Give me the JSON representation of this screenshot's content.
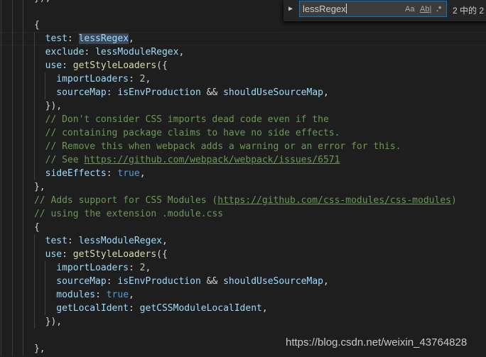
{
  "find_widget": {
    "query": "lessRegex",
    "match_case_label": "Aa",
    "whole_word_label": "Ab|",
    "regex_label": ".*",
    "result_count": "2 中的 2"
  },
  "watermark": "https://blog.csdn.net/weixin_43764828",
  "colors": {
    "background": "#1e1e1e",
    "property": "#9cdcfe",
    "function": "#dcdcaa",
    "number": "#b5cea8",
    "comment": "#6a9955",
    "keyword": "#569cd6"
  },
  "code_lines": [
    {
      "indent": 3,
      "tokens": [
        [
          "p",
          "      }),"
        ]
      ]
    },
    {
      "indent": 3,
      "tokens": []
    },
    {
      "indent": 3,
      "tokens": [
        [
          "p",
          "      {"
        ]
      ]
    },
    {
      "indent": 4,
      "current": true,
      "tokens": [
        [
          "prop",
          "        test"
        ],
        [
          "p",
          ": "
        ],
        [
          "hl",
          "lessRegex"
        ],
        [
          "p",
          ","
        ]
      ]
    },
    {
      "indent": 4,
      "tokens": [
        [
          "prop",
          "        exclude"
        ],
        [
          "p",
          ": "
        ],
        [
          "prop",
          "lessModuleRegex"
        ],
        [
          "p",
          ","
        ]
      ]
    },
    {
      "indent": 4,
      "tokens": [
        [
          "prop",
          "        use"
        ],
        [
          "p",
          ": "
        ],
        [
          "fn",
          "getStyleLoaders"
        ],
        [
          "p",
          "({"
        ]
      ]
    },
    {
      "indent": 5,
      "tokens": [
        [
          "prop",
          "          importLoaders"
        ],
        [
          "p",
          ": "
        ],
        [
          "num",
          "2"
        ],
        [
          "p",
          ","
        ]
      ]
    },
    {
      "indent": 5,
      "tokens": [
        [
          "prop",
          "          sourceMap"
        ],
        [
          "p",
          ": "
        ],
        [
          "prop",
          "isEnvProduction"
        ],
        [
          "p",
          " && "
        ],
        [
          "prop",
          "shouldUseSourceMap"
        ],
        [
          "p",
          ","
        ]
      ]
    },
    {
      "indent": 4,
      "tokens": [
        [
          "p",
          "        }),"
        ]
      ]
    },
    {
      "indent": 4,
      "tokens": [
        [
          "cm",
          "        // Don't consider CSS imports dead code even if the"
        ]
      ]
    },
    {
      "indent": 4,
      "tokens": [
        [
          "cm",
          "        // containing package claims to have no side effects."
        ]
      ]
    },
    {
      "indent": 4,
      "tokens": [
        [
          "cm",
          "        // Remove this when webpack adds a warning or an error for this."
        ]
      ]
    },
    {
      "indent": 4,
      "tokens": [
        [
          "cm",
          "        // See "
        ],
        [
          "link",
          "https://github.com/webpack/webpack/issues/6571"
        ]
      ]
    },
    {
      "indent": 4,
      "tokens": [
        [
          "prop",
          "        sideEffects"
        ],
        [
          "p",
          ": "
        ],
        [
          "kw",
          "true"
        ],
        [
          "p",
          ","
        ]
      ]
    },
    {
      "indent": 3,
      "tokens": [
        [
          "p",
          "      },"
        ]
      ]
    },
    {
      "indent": 3,
      "tokens": [
        [
          "cm",
          "      // Adds support for CSS Modules ("
        ],
        [
          "link",
          "https://github.com/css-modules/css-modules"
        ],
        [
          "cm",
          ")"
        ]
      ]
    },
    {
      "indent": 3,
      "tokens": [
        [
          "cm",
          "      // using the extension .module.css"
        ]
      ]
    },
    {
      "indent": 3,
      "tokens": [
        [
          "p",
          "      {"
        ]
      ]
    },
    {
      "indent": 4,
      "tokens": [
        [
          "prop",
          "        test"
        ],
        [
          "p",
          ": "
        ],
        [
          "prop",
          "lessModuleRegex"
        ],
        [
          "p",
          ","
        ]
      ]
    },
    {
      "indent": 4,
      "tokens": [
        [
          "prop",
          "        use"
        ],
        [
          "p",
          ": "
        ],
        [
          "fn",
          "getStyleLoaders"
        ],
        [
          "p",
          "({"
        ]
      ]
    },
    {
      "indent": 5,
      "tokens": [
        [
          "prop",
          "          importLoaders"
        ],
        [
          "p",
          ": "
        ],
        [
          "num",
          "2"
        ],
        [
          "p",
          ","
        ]
      ]
    },
    {
      "indent": 5,
      "tokens": [
        [
          "prop",
          "          sourceMap"
        ],
        [
          "p",
          ": "
        ],
        [
          "prop",
          "isEnvProduction"
        ],
        [
          "p",
          " && "
        ],
        [
          "prop",
          "shouldUseSourceMap"
        ],
        [
          "p",
          ","
        ]
      ]
    },
    {
      "indent": 5,
      "tokens": [
        [
          "prop",
          "          modules"
        ],
        [
          "p",
          ": "
        ],
        [
          "kw",
          "true"
        ],
        [
          "p",
          ","
        ]
      ]
    },
    {
      "indent": 5,
      "tokens": [
        [
          "prop",
          "          getLocalIdent"
        ],
        [
          "p",
          ": "
        ],
        [
          "prop",
          "getCSSModuleLocalIdent"
        ],
        [
          "p",
          ","
        ]
      ]
    },
    {
      "indent": 4,
      "tokens": [
        [
          "p",
          "        }),"
        ]
      ]
    },
    {
      "indent": 3,
      "tokens": []
    },
    {
      "indent": 3,
      "tokens": [
        [
          "p",
          "      },"
        ]
      ]
    }
  ]
}
